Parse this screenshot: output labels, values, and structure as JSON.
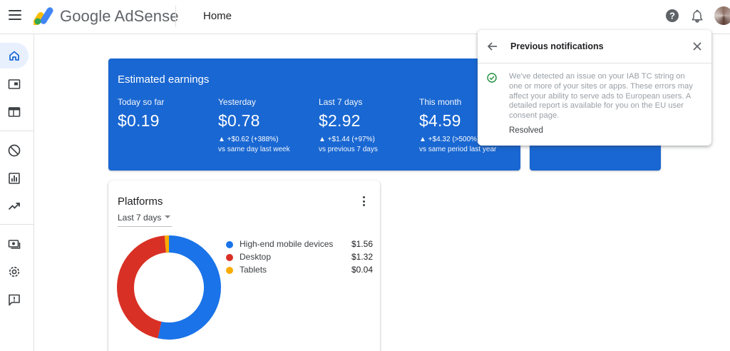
{
  "app": {
    "brand": "Google AdSense",
    "page_title": "Home"
  },
  "colors": {
    "accent": "#1967d2",
    "high_end_mobile": "#1a73e8",
    "desktop": "#d93025",
    "tablets": "#f9ab00",
    "resolved_green": "#1e8e3e"
  },
  "sidebar": {
    "items": [
      {
        "icon": "home-icon",
        "active": true
      },
      {
        "icon": "ads-icon",
        "active": false
      },
      {
        "icon": "sites-icon",
        "active": false
      },
      {
        "icon": "block-icon",
        "active": false
      },
      {
        "icon": "reports-icon",
        "active": false
      },
      {
        "icon": "optimization-icon",
        "active": false
      },
      {
        "icon": "payments-icon",
        "active": false
      },
      {
        "icon": "settings-icon",
        "active": false
      },
      {
        "icon": "feedback-icon",
        "active": false
      }
    ]
  },
  "earnings": {
    "title": "Estimated earnings",
    "metrics": [
      {
        "label": "Today so far",
        "value": "$0.19",
        "change": "",
        "sub": ""
      },
      {
        "label": "Yesterday",
        "value": "$0.78",
        "change": "▲ +$0.62 (+388%)",
        "sub": "vs same day last week"
      },
      {
        "label": "Last 7 days",
        "value": "$2.92",
        "change": "▲ +$1.44 (+97%)",
        "sub": "vs previous 7 days"
      },
      {
        "label": "This month",
        "value": "$4.59",
        "change": "▲ +$4.32 (>500%)",
        "sub": "vs same period last year"
      }
    ]
  },
  "platforms": {
    "title": "Platforms",
    "range": "Last 7 days",
    "legend": [
      {
        "label": "High-end mobile devices",
        "value": "$1.56"
      },
      {
        "label": "Desktop",
        "value": "$1.32"
      },
      {
        "label": "Tablets",
        "value": "$0.04"
      }
    ],
    "donut_values": [
      1.56,
      1.32,
      0.04
    ]
  },
  "notifications": {
    "title": "Previous notifications",
    "message": "We've detected an issue on your IAB TC string on one or more of your sites or apps. These errors may affect your ability to serve ads to European users. A detailed report is available for you on the EU user consent page.",
    "status": "Resolved"
  }
}
